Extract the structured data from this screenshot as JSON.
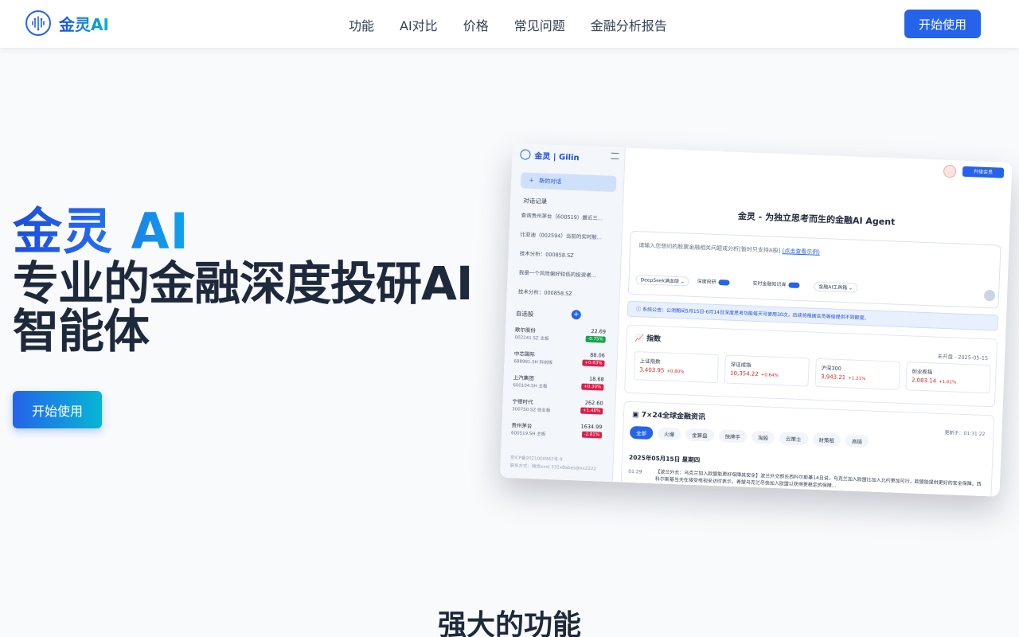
{
  "nav": {
    "brand": "金灵AI",
    "links": [
      "功能",
      "AI对比",
      "价格",
      "常见问题",
      "金融分析报告"
    ],
    "cta": "开始使用"
  },
  "hero": {
    "brand": "金灵 AI",
    "title": "专业的金融深度投研AI智能体",
    "cta": "开始使用"
  },
  "app": {
    "brand": "金灵 | Gilin",
    "new_chat": "新的对话",
    "history_label": "对话记录",
    "history": [
      "查询贵州茅台（600519）最近三...",
      "比亚迪（002594）当前的实时股...",
      "技术分析：000858.SZ",
      "我是一个风险偏好较低的投资者...",
      "技术分析：000858.SZ"
    ],
    "watchlist_label": "自选股",
    "stocks": [
      {
        "name": "歌尔股份",
        "code": "002241.SZ",
        "tag": "主板",
        "price": "22.69",
        "change": "-0.75%",
        "up": false
      },
      {
        "name": "中芯国际",
        "code": "688981.SH",
        "tag": "科创板",
        "price": "88.06",
        "change": "+0.63%",
        "up": true
      },
      {
        "name": "上汽集团",
        "code": "600104.SH",
        "tag": "主板",
        "price": "18.68",
        "change": "+0.30%",
        "up": true
      },
      {
        "name": "宁德时代",
        "code": "300750.SZ",
        "tag": "创业板",
        "price": "262.60",
        "change": "+1.48%",
        "up": true
      },
      {
        "name": "贵州茅台",
        "code": "600519.SH",
        "tag": "主板",
        "price": "1634.99",
        "change": "-2.81%",
        "up": true
      }
    ],
    "footer_line1": "京ICP备2021000962号-9",
    "footer_line2": "联系方式：微信xxx|  332xBabes@xx2222",
    "vip": "升级会员",
    "main_title": "金灵 - 为独立思考而生的金融AI Agent",
    "input_placeholder": "请输入您想问的股票金融相关问题或分析[暂时只支持A股]",
    "input_link": "(点击查看示例)",
    "chip_model": "DeepSeek满血版",
    "chip_deep": "深度投研",
    "chip_kb": "实时金融知识库",
    "chip_tools": "金融AI工具箱",
    "notice": "系统公告：公测期间5月15日-6月14日深度思考功能每天可使用30次，后续将根据会员等级提供不同额度。",
    "index_title": "指数",
    "index_date": "未开盘 · 2025-05-15",
    "indices": [
      {
        "name": "上证指数",
        "value": "3,403.95",
        "change": "+0.80%"
      },
      {
        "name": "深证成指",
        "value": "10,354.22",
        "change": "+0.64%"
      },
      {
        "name": "沪深300",
        "value": "3,943.21",
        "change": "+1.21%"
      },
      {
        "name": "创业板指",
        "value": "2,083.14",
        "change": "+1.01%"
      }
    ],
    "news_title": "7×24全球金融资讯",
    "news_updated": "更新于：01:31:22",
    "news_tabs": [
      "全部",
      "火爆",
      "金算盘",
      "快牌手",
      "淘股",
      "云策士",
      "财策租",
      "高链"
    ],
    "news_date": "2025年05月15日 星期四",
    "news_time": "01:29",
    "news_text": "【波兰外长：乌克兰加入欧盟能更好保障其安全】波兰外交部长西科尔斯基14日说，乌克兰加入欧盟比加入北约更加可行，欧盟能提供更好的安全保障。西科尔斯基当天在接受电视采访时表示，希望乌克兰尽快加入欧盟以获得更稳定的保障..."
  },
  "section": {
    "title": "强大的功能"
  }
}
